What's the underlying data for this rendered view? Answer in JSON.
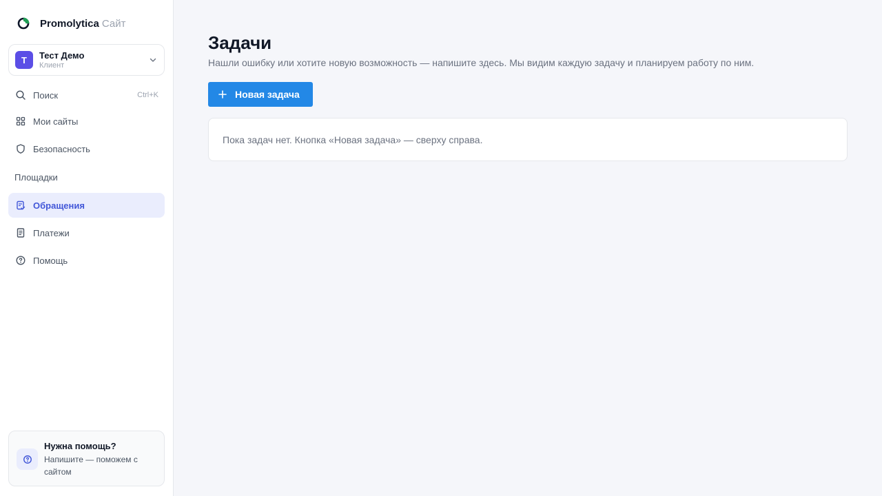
{
  "brand": {
    "name": "Promolytica",
    "suffix": "Сайт"
  },
  "account": {
    "initial": "Т",
    "name": "Тест Демо",
    "role": "Клиент"
  },
  "nav": {
    "search": {
      "label": "Поиск",
      "shortcut": "Ctrl+K"
    },
    "my_sites": "Мои сайты",
    "security": "Безопасность",
    "platforms_label": "Площадки",
    "requests": "Обращения",
    "payments": "Платежи",
    "help": "Помощь"
  },
  "help_card": {
    "title": "Нужна помощь?",
    "text": "Напишите — поможем с сайтом"
  },
  "main": {
    "title": "Задачи",
    "subtitle": "Нашли ошибку или хотите новую возможность — напишите здесь. Мы видим каждую задачу и планируем работу по ним.",
    "new_task_label": "Новая задача",
    "empty_message": "Пока задач нет. Кнопка «Новая задача» — сверху справа."
  },
  "colors": {
    "accent": "#2388e6",
    "active_nav_bg": "#eaedfd",
    "active_nav_text": "#4257d8",
    "avatar": "#5b4ee6",
    "logo_green": "#1f9d55"
  },
  "icons": {
    "logo": "promolytica-logo-icon",
    "chevron": "chevron-down-icon",
    "search": "search-icon",
    "sites": "grid-icon",
    "security": "shield-icon",
    "requests": "clipboard-check-icon",
    "payments": "receipt-icon",
    "help": "question-circle-icon",
    "plus": "plus-icon"
  }
}
